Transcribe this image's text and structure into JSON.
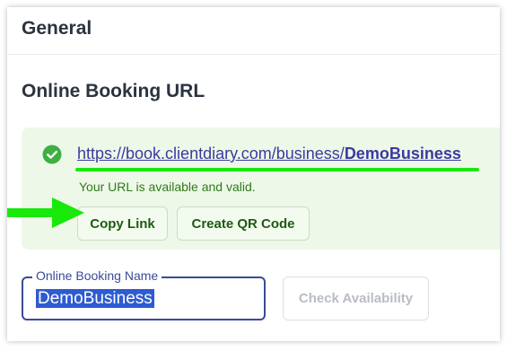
{
  "general": {
    "title": "General"
  },
  "booking_url": {
    "title": "Online Booking URL",
    "url_prefix": "https://book.clientdiary.com/business/",
    "url_business": "DemoBusiness",
    "status": "Your URL is available and valid.",
    "copy_label": "Copy Link",
    "qr_label": "Create QR Code"
  },
  "booking_name": {
    "label": "Online Booking Name",
    "value": "DemoBusiness",
    "check_label": "Check Availability"
  },
  "colors": {
    "accent": "#3a4a9a",
    "success": "#3cb043",
    "highlight": "#18e80a",
    "selection": "#2e5bd1"
  },
  "icons": {
    "status": "check-circle-icon",
    "pointer": "arrow-right-icon"
  }
}
